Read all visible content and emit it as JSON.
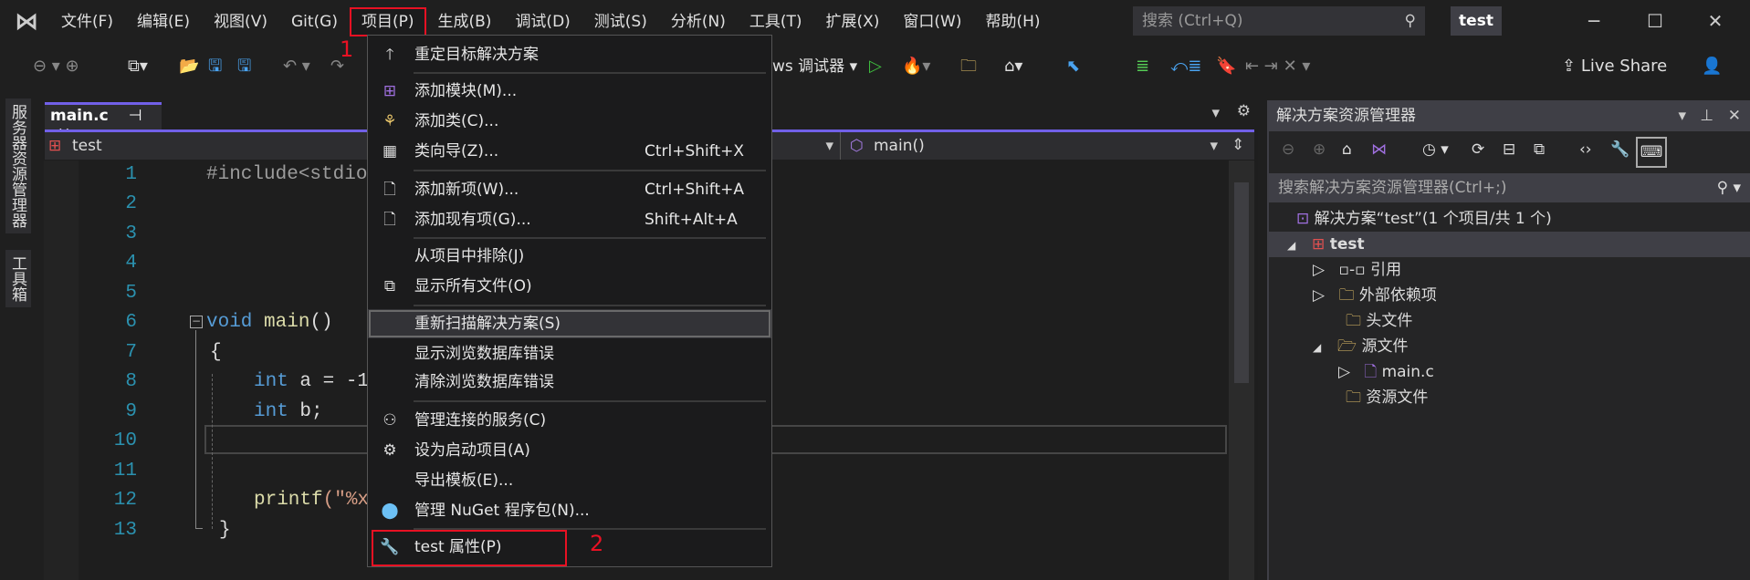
{
  "titlebar": {
    "menu": [
      "文件(F)",
      "编辑(E)",
      "视图(V)",
      "Git(G)",
      "项目(P)",
      "生成(B)",
      "调试(D)",
      "测试(S)",
      "分析(N)",
      "工具(T)",
      "扩展(X)",
      "窗口(W)",
      "帮助(H)"
    ],
    "search_placeholder": "搜索 (Ctrl+Q)",
    "project_badge": "test"
  },
  "toolbar": {
    "debugger": "ws 调试器",
    "live_share": "Live Share"
  },
  "left_tabs": [
    "服务器资源管理器",
    "工具箱"
  ],
  "editor": {
    "tab": "main.c",
    "nav_project": "test",
    "nav_function": "main()",
    "line_numbers": [
      "1",
      "2",
      "3",
      "4",
      "5",
      "6",
      "7",
      "8",
      "9",
      "10",
      "11",
      "12",
      "13"
    ],
    "code": {
      "l1": "#include<stdio",
      "l6a": "void",
      "l6b": " main",
      "l6c": "()",
      "l7": "{",
      "l8a": "int",
      "l8b": " a = -1",
      "l9a": "int",
      "l9b": " b;",
      "l12a": "printf",
      "l12b": "(\"%x",
      "l13": "}"
    }
  },
  "solution_explorer": {
    "title": "解决方案资源管理器",
    "search_placeholder": "搜索解决方案资源管理器(Ctrl+;)",
    "tree": [
      "解决方案“test”(1 个项目/共 1 个)",
      "test",
      "引用",
      "外部依赖项",
      "头文件",
      "源文件",
      "main.c",
      "资源文件"
    ]
  },
  "project_menu": {
    "items": [
      {
        "label": "重定目标解决方案",
        "shortcut": ""
      },
      {
        "label": "添加模块(M)...",
        "shortcut": ""
      },
      {
        "label": "添加类(C)...",
        "shortcut": ""
      },
      {
        "label": "类向导(Z)...",
        "shortcut": "Ctrl+Shift+X"
      },
      {
        "label": "添加新项(W)...",
        "shortcut": "Ctrl+Shift+A"
      },
      {
        "label": "添加现有项(G)...",
        "shortcut": "Shift+Alt+A"
      },
      {
        "label": "从项目中排除(J)",
        "shortcut": ""
      },
      {
        "label": "显示所有文件(O)",
        "shortcut": ""
      },
      {
        "label": "重新扫描解决方案(S)",
        "shortcut": ""
      },
      {
        "label": "显示浏览数据库错误",
        "shortcut": ""
      },
      {
        "label": "清除浏览数据库错误",
        "shortcut": ""
      },
      {
        "label": "管理连接的服务(C)",
        "shortcut": ""
      },
      {
        "label": "设为启动项目(A)",
        "shortcut": ""
      },
      {
        "label": "导出模板(E)...",
        "shortcut": ""
      },
      {
        "label": "管理 NuGet 程序包(N)...",
        "shortcut": ""
      },
      {
        "label": "test 属性(P)",
        "shortcut": ""
      }
    ]
  },
  "annotations": [
    "1",
    "2"
  ],
  "colors": {
    "accent": "#7160e8",
    "annotation": "#e81123"
  }
}
